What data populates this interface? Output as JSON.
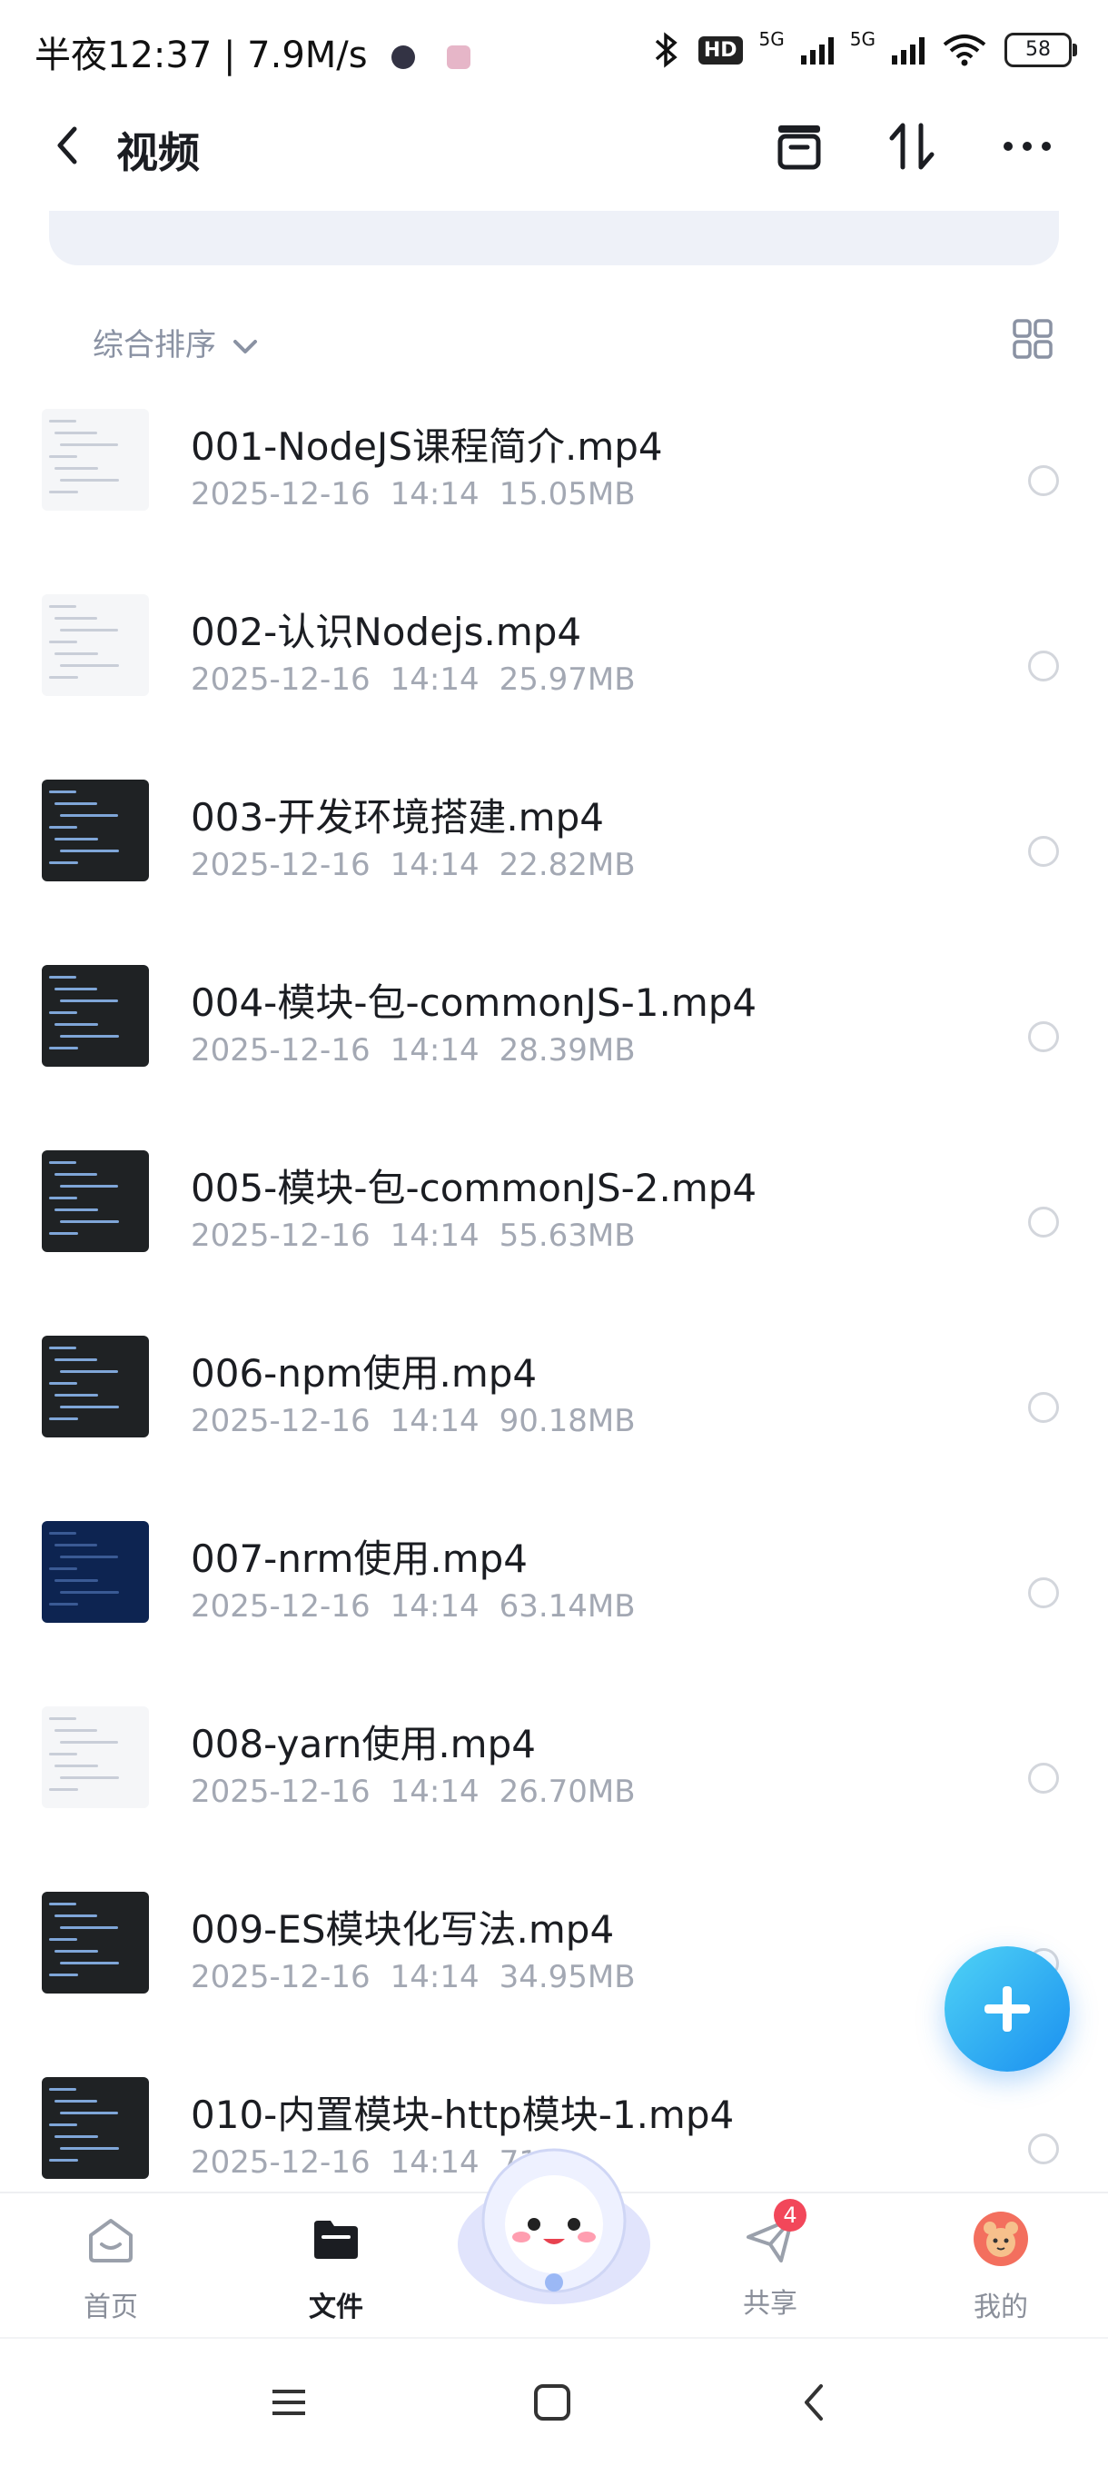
{
  "status_bar": {
    "time_text": "半夜12:37 | 7.9M/s",
    "network_1": "5G",
    "network_2": "5G",
    "hd_label": "HD",
    "battery": "58"
  },
  "header": {
    "title": "视频"
  },
  "toolbar": {
    "sort_label": "综合排序"
  },
  "files": [
    {
      "name": "001-NodeJS课程简介.mp4",
      "date": "2025-12-16",
      "time": "14:14",
      "size": "15.05MB",
      "thumb": "light"
    },
    {
      "name": "002-认识Nodejs.mp4",
      "date": "2025-12-16",
      "time": "14:14",
      "size": "25.97MB",
      "thumb": "light"
    },
    {
      "name": "003-开发环境搭建.mp4",
      "date": "2025-12-16",
      "time": "14:14",
      "size": "22.82MB",
      "thumb": "dark"
    },
    {
      "name": "004-模块-包-commonJS-1.mp4",
      "date": "2025-12-16",
      "time": "14:14",
      "size": "28.39MB",
      "thumb": "dark"
    },
    {
      "name": "005-模块-包-commonJS-2.mp4",
      "date": "2025-12-16",
      "time": "14:14",
      "size": "55.63MB",
      "thumb": "dark"
    },
    {
      "name": "006-npm使用.mp4",
      "date": "2025-12-16",
      "time": "14:14",
      "size": "90.18MB",
      "thumb": "dark"
    },
    {
      "name": "007-nrm使用.mp4",
      "date": "2025-12-16",
      "time": "14:14",
      "size": "63.14MB",
      "thumb": "navy"
    },
    {
      "name": "008-yarn使用.mp4",
      "date": "2025-12-16",
      "time": "14:14",
      "size": "26.70MB",
      "thumb": "light"
    },
    {
      "name": "009-ES模块化写法.mp4",
      "date": "2025-12-16",
      "time": "14:14",
      "size": "34.95MB",
      "thumb": "dark"
    },
    {
      "name": "010-内置模块-http模块-1.mp4",
      "date": "2025-12-16",
      "time": "14:14",
      "size": "71",
      "thumb": "dark"
    }
  ],
  "tabbar": {
    "home": "首页",
    "files": "文件",
    "share": "共享",
    "share_badge": "4",
    "mine": "我的"
  },
  "colors": {
    "accent": "#1a8ff0",
    "badge": "#f2475a",
    "muted": "#a3a8b3"
  }
}
